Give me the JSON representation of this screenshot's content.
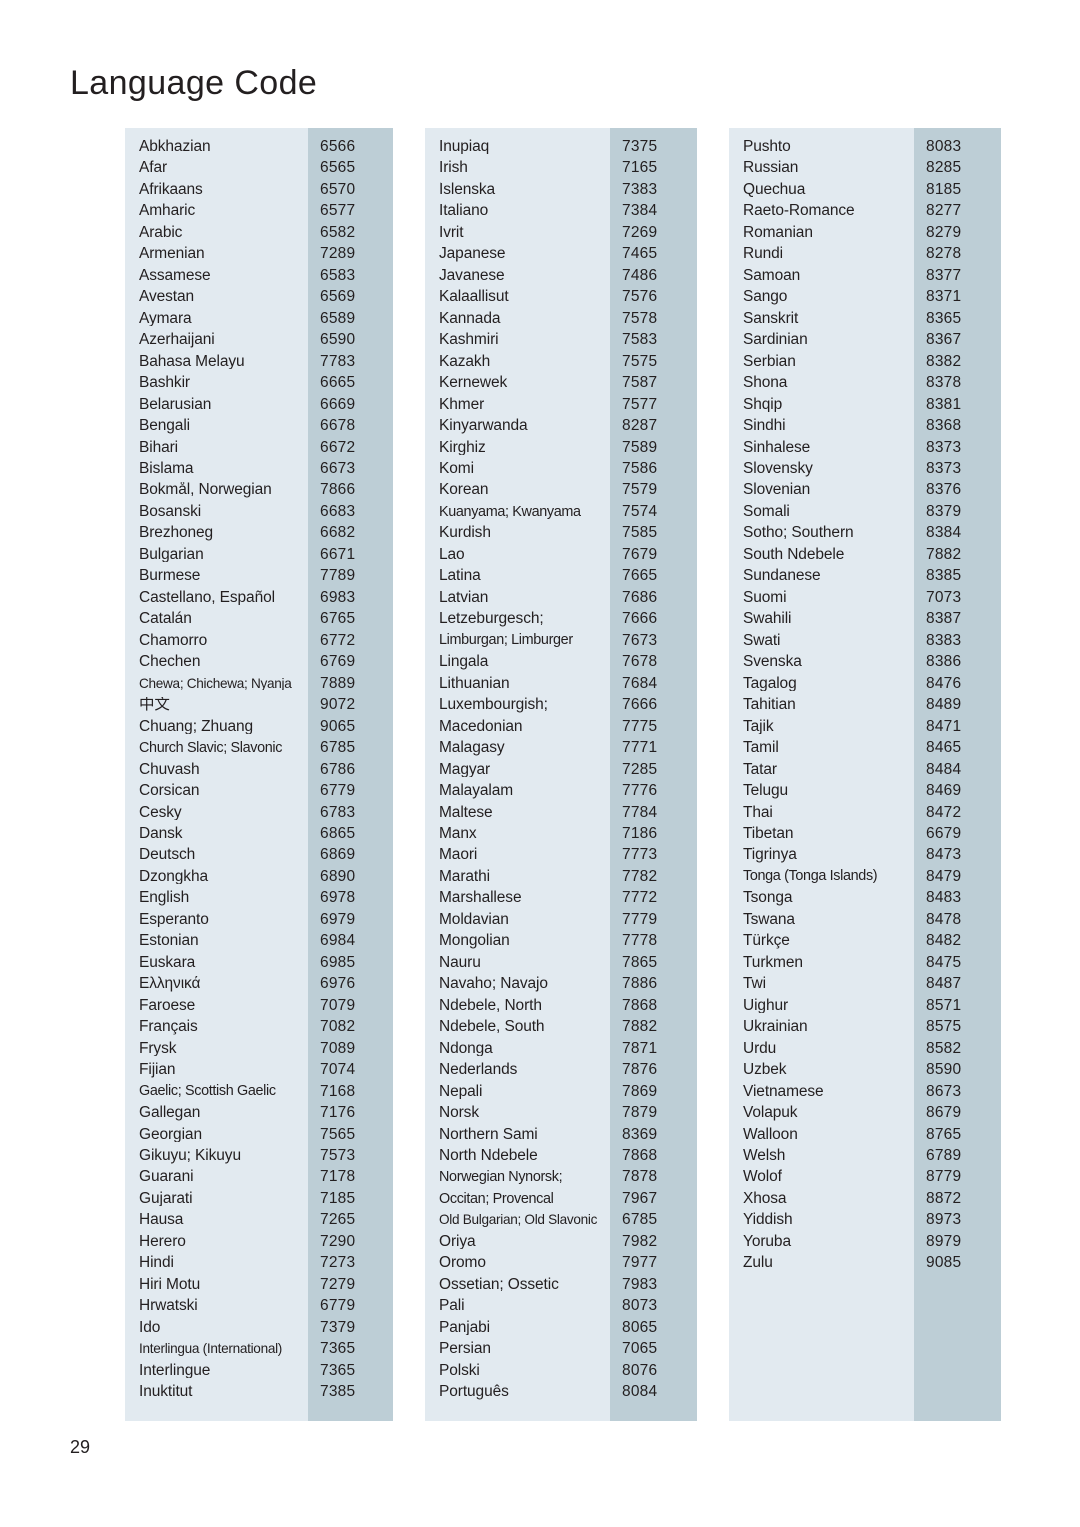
{
  "document": {
    "title": "Language Code",
    "page_number": "29"
  },
  "colors": {
    "column_background": "#e2eaf0",
    "code_strip_background": "#bdced6",
    "text": "#231f20",
    "page_background": "#ffffff"
  },
  "table": {
    "columns": [
      {
        "id": "column-1",
        "rows": [
          {
            "language": "Abkhazian",
            "code": "6566"
          },
          {
            "language": "Afar",
            "code": "6565"
          },
          {
            "language": "Afrikaans",
            "code": "6570"
          },
          {
            "language": "Amharic",
            "code": "6577"
          },
          {
            "language": "Arabic",
            "code": "6582"
          },
          {
            "language": "Armenian",
            "code": "7289"
          },
          {
            "language": "Assamese",
            "code": "6583"
          },
          {
            "language": "Avestan",
            "code": "6569"
          },
          {
            "language": "Aymara",
            "code": "6589"
          },
          {
            "language": "Azerhaijani",
            "code": "6590"
          },
          {
            "language": "Bahasa Melayu",
            "code": "7783"
          },
          {
            "language": "Bashkir",
            "code": "6665"
          },
          {
            "language": "Belarusian",
            "code": "6669"
          },
          {
            "language": "Bengali",
            "code": "6678"
          },
          {
            "language": "Bihari",
            "code": "6672"
          },
          {
            "language": "Bislama",
            "code": "6673"
          },
          {
            "language": "Bokmål, Norwegian",
            "code": "7866"
          },
          {
            "language": "Bosanski",
            "code": "6683"
          },
          {
            "language": "Brezhoneg",
            "code": "6682"
          },
          {
            "language": "Bulgarian",
            "code": "6671"
          },
          {
            "language": "Burmese",
            "code": "7789"
          },
          {
            "language": "Castellano, Español",
            "code": "6983"
          },
          {
            "language": "Catalán",
            "code": "6765"
          },
          {
            "language": "Chamorro",
            "code": "6772"
          },
          {
            "language": "Chechen",
            "code": "6769"
          },
          {
            "language": "Chewa; Chichewa; Nyanja",
            "code": "7889",
            "fit": "tight"
          },
          {
            "language": "中文",
            "code": "9072"
          },
          {
            "language": "Chuang; Zhuang",
            "code": "9065"
          },
          {
            "language": "Church Slavic; Slavonic",
            "code": "6785",
            "fit": "tight2"
          },
          {
            "language": "Chuvash",
            "code": "6786"
          },
          {
            "language": "Corsican",
            "code": "6779"
          },
          {
            "language": "Česky",
            "code": "6783"
          },
          {
            "language": "Dansk",
            "code": "6865"
          },
          {
            "language": "Deutsch",
            "code": "6869"
          },
          {
            "language": "Dzongkha",
            "code": "6890"
          },
          {
            "language": "English",
            "code": "6978"
          },
          {
            "language": "Esperanto",
            "code": "6979"
          },
          {
            "language": "Estonian",
            "code": "6984"
          },
          {
            "language": "Euskara",
            "code": "6985"
          },
          {
            "language": "Ελληνικά",
            "code": "6976"
          },
          {
            "language": "Faroese",
            "code": "7079"
          },
          {
            "language": "Français",
            "code": "7082"
          },
          {
            "language": "Frysk",
            "code": "7089"
          },
          {
            "language": "Fijian",
            "code": "7074"
          },
          {
            "language": "Gaelic; Scottish Gaelic",
            "code": "7168",
            "fit": "tight2"
          },
          {
            "language": "Gallegan",
            "code": "7176"
          },
          {
            "language": "Georgian",
            "code": "7565"
          },
          {
            "language": "Gikuyu; Kikuyu",
            "code": "7573"
          },
          {
            "language": "Guarani",
            "code": "7178"
          },
          {
            "language": "Gujarati",
            "code": "7185"
          },
          {
            "language": "Hausa",
            "code": "7265"
          },
          {
            "language": "Herero",
            "code": "7290"
          },
          {
            "language": "Hindi",
            "code": "7273"
          },
          {
            "language": "Hiri Motu",
            "code": "7279"
          },
          {
            "language": "Hrwatski",
            "code": "6779"
          },
          {
            "language": "Ido",
            "code": "7379"
          },
          {
            "language": "Interlingua (International)",
            "code": "7365",
            "fit": "tight"
          },
          {
            "language": "Interlingue",
            "code": "7365"
          },
          {
            "language": "Inuktitut",
            "code": "7385"
          }
        ]
      },
      {
        "id": "column-2",
        "rows": [
          {
            "language": "Inupiaq",
            "code": "7375"
          },
          {
            "language": "Irish",
            "code": "7165"
          },
          {
            "language": "Íslenska",
            "code": "7383"
          },
          {
            "language": "Italiano",
            "code": "7384"
          },
          {
            "language": "Ivrit",
            "code": "7269"
          },
          {
            "language": "Japanese",
            "code": "7465"
          },
          {
            "language": "Javanese",
            "code": "7486"
          },
          {
            "language": "Kalaallisut",
            "code": "7576"
          },
          {
            "language": "Kannada",
            "code": "7578"
          },
          {
            "language": "Kashmiri",
            "code": "7583"
          },
          {
            "language": "Kazakh",
            "code": "7575"
          },
          {
            "language": "Kernewek",
            "code": "7587"
          },
          {
            "language": "Khmer",
            "code": "7577"
          },
          {
            "language": "Kinyarwanda",
            "code": "8287"
          },
          {
            "language": "Kirghiz",
            "code": "7589"
          },
          {
            "language": "Komi",
            "code": "7586"
          },
          {
            "language": "Korean",
            "code": "7579"
          },
          {
            "language": "Kuanyama; Kwanyama",
            "code": "7574",
            "fit": "tight2"
          },
          {
            "language": "Kurdish",
            "code": "7585"
          },
          {
            "language": "Lao",
            "code": "7679"
          },
          {
            "language": "Latina",
            "code": "7665"
          },
          {
            "language": "Latvian",
            "code": "7686"
          },
          {
            "language": "Letzeburgesch;",
            "code": "7666"
          },
          {
            "language": "Limburgan; Limburger",
            "code": "7673",
            "fit": "tight2"
          },
          {
            "language": "Lingala",
            "code": "7678"
          },
          {
            "language": "Lithuanian",
            "code": "7684"
          },
          {
            "language": "Luxembourgish;",
            "code": "7666"
          },
          {
            "language": "Macedonian",
            "code": "7775"
          },
          {
            "language": "Malagasy",
            "code": "7771"
          },
          {
            "language": "Magyar",
            "code": "7285"
          },
          {
            "language": "Malayalam",
            "code": "7776"
          },
          {
            "language": "Maltese",
            "code": "7784"
          },
          {
            "language": "Manx",
            "code": "7186"
          },
          {
            "language": "Maori",
            "code": "7773"
          },
          {
            "language": "Marathi",
            "code": "7782"
          },
          {
            "language": "Marshallese",
            "code": "7772"
          },
          {
            "language": "Moldavian",
            "code": "7779"
          },
          {
            "language": "Mongolian",
            "code": "7778"
          },
          {
            "language": "Nauru",
            "code": "7865"
          },
          {
            "language": "Navaho; Navajo",
            "code": "7886"
          },
          {
            "language": "Ndebele, North",
            "code": "7868"
          },
          {
            "language": "Ndebele, South",
            "code": "7882"
          },
          {
            "language": "Ndonga",
            "code": "7871"
          },
          {
            "language": "Nederlands",
            "code": "7876"
          },
          {
            "language": "Nepali",
            "code": "7869"
          },
          {
            "language": "Norsk",
            "code": "7879"
          },
          {
            "language": "Northern Sami",
            "code": "8369"
          },
          {
            "language": "North Ndebele",
            "code": "7868"
          },
          {
            "language": "Norwegian Nynorsk;",
            "code": "7878",
            "fit": "tight2"
          },
          {
            "language": "Occitan; Provencal",
            "code": "7967",
            "fit": "tight2"
          },
          {
            "language": "Old Bulgarian; Old Slavonic",
            "code": "6785",
            "fit": "tight"
          },
          {
            "language": "Oriya",
            "code": "7982"
          },
          {
            "language": "Oromo",
            "code": "7977"
          },
          {
            "language": "Ossetian; Ossetic",
            "code": "7983"
          },
          {
            "language": "Pali",
            "code": "8073"
          },
          {
            "language": "Panjabi",
            "code": "8065"
          },
          {
            "language": "Persian",
            "code": "7065"
          },
          {
            "language": "Polski",
            "code": "8076"
          },
          {
            "language": "Português",
            "code": "8084"
          }
        ]
      },
      {
        "id": "column-3",
        "rows": [
          {
            "language": "Pushto",
            "code": "8083"
          },
          {
            "language": "Russian",
            "code": "8285"
          },
          {
            "language": "Quechua",
            "code": "8185"
          },
          {
            "language": "Raeto-Romance",
            "code": "8277"
          },
          {
            "language": "Romanian",
            "code": "8279"
          },
          {
            "language": "Rundi",
            "code": "8278"
          },
          {
            "language": "Samoan",
            "code": "8377"
          },
          {
            "language": "Sango",
            "code": "8371"
          },
          {
            "language": "Sanskrit",
            "code": "8365"
          },
          {
            "language": "Sardinian",
            "code": "8367"
          },
          {
            "language": "Serbian",
            "code": "8382"
          },
          {
            "language": "Shona",
            "code": "8378"
          },
          {
            "language": "Shqip",
            "code": "8381"
          },
          {
            "language": "Sindhi",
            "code": "8368"
          },
          {
            "language": "Sinhalese",
            "code": "8373"
          },
          {
            "language": "Slovensky",
            "code": "8373"
          },
          {
            "language": "Slovenian",
            "code": "8376"
          },
          {
            "language": "Somali",
            "code": "8379"
          },
          {
            "language": "Sotho; Southern",
            "code": "8384"
          },
          {
            "language": "South Ndebele",
            "code": "7882"
          },
          {
            "language": "Sundanese",
            "code": "8385"
          },
          {
            "language": "Suomi",
            "code": "7073"
          },
          {
            "language": "Swahili",
            "code": "8387"
          },
          {
            "language": "Swati",
            "code": "8383"
          },
          {
            "language": "Svenska",
            "code": "8386"
          },
          {
            "language": "Tagalog",
            "code": "8476"
          },
          {
            "language": "Tahitian",
            "code": "8489"
          },
          {
            "language": "Tajik",
            "code": "8471"
          },
          {
            "language": "Tamil",
            "code": "8465"
          },
          {
            "language": "Tatar",
            "code": "8484"
          },
          {
            "language": "Telugu",
            "code": "8469"
          },
          {
            "language": "Thai",
            "code": "8472"
          },
          {
            "language": "Tibetan",
            "code": "6679"
          },
          {
            "language": "Tigrinya",
            "code": "8473"
          },
          {
            "language": "Tonga (Tonga Islands)",
            "code": "8479",
            "fit": "tight2"
          },
          {
            "language": "Tsonga",
            "code": "8483"
          },
          {
            "language": "Tswana",
            "code": "8478"
          },
          {
            "language": "Türkçe",
            "code": "8482"
          },
          {
            "language": "Turkmen",
            "code": "8475"
          },
          {
            "language": "Twi",
            "code": "8487"
          },
          {
            "language": "Uighur",
            "code": "8571"
          },
          {
            "language": "Ukrainian",
            "code": "8575"
          },
          {
            "language": "Urdu",
            "code": "8582"
          },
          {
            "language": "Uzbek",
            "code": "8590"
          },
          {
            "language": "Vietnamese",
            "code": "8673"
          },
          {
            "language": "Volapuk",
            "code": "8679"
          },
          {
            "language": "Walloon",
            "code": "8765"
          },
          {
            "language": "Welsh",
            "code": "6789"
          },
          {
            "language": "Wolof",
            "code": "8779"
          },
          {
            "language": "Xhosa",
            "code": "8872"
          },
          {
            "language": "Yiddish",
            "code": "8973"
          },
          {
            "language": "Yoruba",
            "code": "8979"
          },
          {
            "language": "Zulu",
            "code": "9085"
          }
        ]
      }
    ]
  }
}
